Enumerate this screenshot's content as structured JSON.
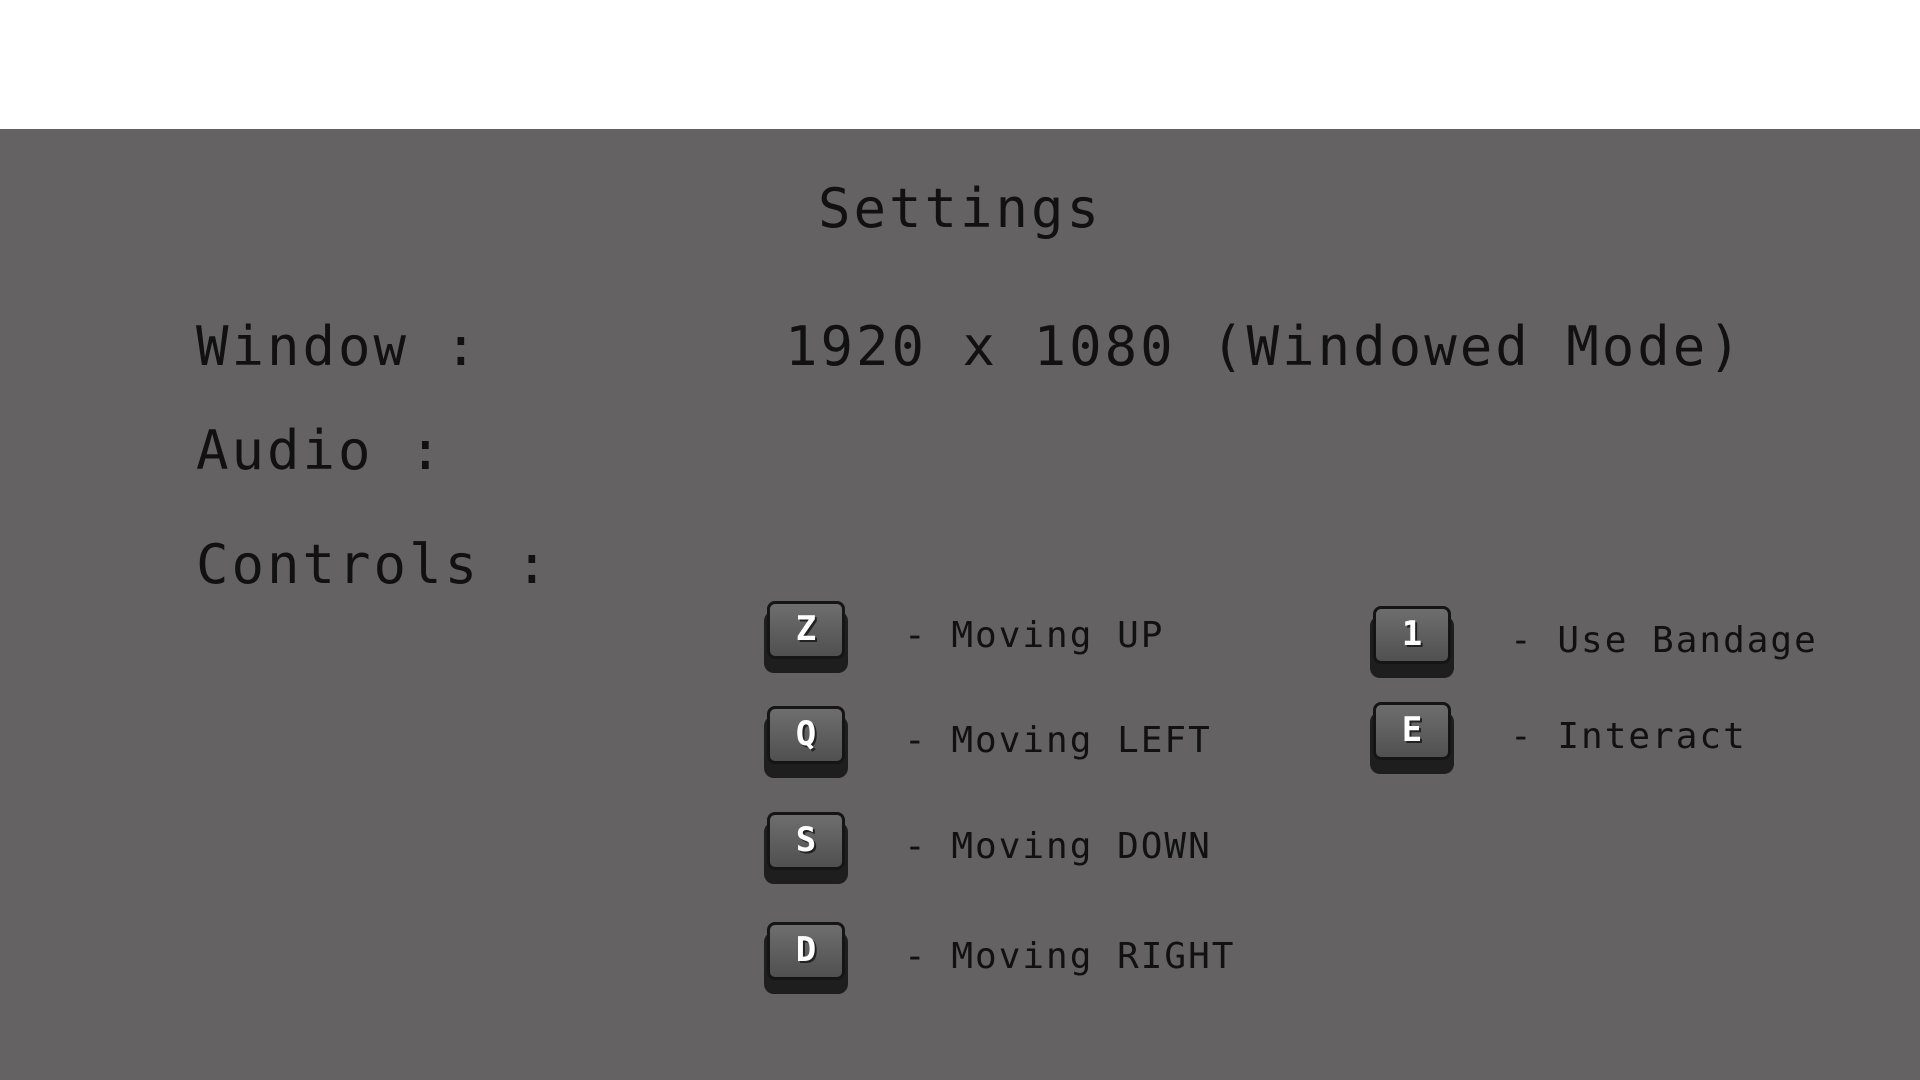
{
  "settings": {
    "title": "Settings",
    "window_label": "Window :",
    "window_value": "1920 x 1080 (Windowed Mode)",
    "audio_label": "Audio :",
    "controls_label": "Controls :"
  },
  "controls": [
    {
      "key": "Z",
      "action": "- Moving UP"
    },
    {
      "key": "Q",
      "action": "- Moving LEFT"
    },
    {
      "key": "S",
      "action": "- Moving DOWN"
    },
    {
      "key": "D",
      "action": "- Moving RIGHT"
    },
    {
      "key": "1",
      "action": "- Use Bandage"
    },
    {
      "key": "E",
      "action": "- Interact"
    }
  ],
  "colors": {
    "panel": "#646263",
    "text": "#111111",
    "keycap": "#5a5a5a"
  }
}
